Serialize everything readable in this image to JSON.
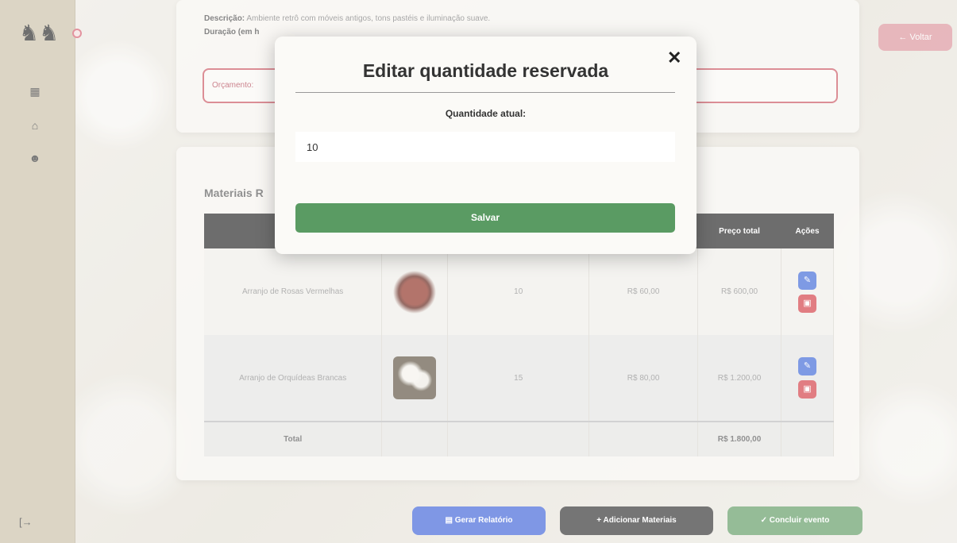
{
  "app": {
    "logo_glyph": "♞♞",
    "back_label": "← Voltar"
  },
  "sidebar": {
    "items": [
      {
        "icon": "calendar-icon",
        "glyph": "▦"
      },
      {
        "icon": "store-icon",
        "glyph": "⌂"
      },
      {
        "icon": "user-icon",
        "glyph": "☻"
      }
    ],
    "logout_glyph": "[→"
  },
  "event": {
    "description_label": "Descrição:",
    "description_value": "Ambiente retrô com móveis antigos, tons pastéis e iluminação suave.",
    "duration_label": "Duração (em h",
    "budget_label": "Orçamento:"
  },
  "materials": {
    "title": "Materiais R",
    "headers": [
      "",
      "",
      "",
      "",
      "Preço total",
      "Ações"
    ],
    "rows": [
      {
        "name": "Arranjo de Rosas Vermelhas",
        "qty": "10",
        "unit_price": "R$ 60,00",
        "total": "R$ 600,00"
      },
      {
        "name": "Arranjo de Orquídeas Brancas",
        "qty": "15",
        "unit_price": "R$ 80,00",
        "total": "R$ 1.200,00"
      }
    ],
    "total_label": "Total",
    "total_value": "R$ 1.800,00"
  },
  "actions": {
    "report_label": "Gerar Relatório",
    "add_label": "+ Adicionar Materiais",
    "finish_label": "✓ Concluir evento"
  },
  "modal": {
    "title": "Editar quantidade reservada",
    "close_glyph": "✕",
    "quantity_label": "Quantidade atual:",
    "quantity_value": "10",
    "save_label": "Salvar"
  },
  "colors": {
    "sidebar": "#c9bfa7",
    "save": "#5a9b63",
    "edit": "#3a64d6",
    "delete": "#d23840"
  }
}
